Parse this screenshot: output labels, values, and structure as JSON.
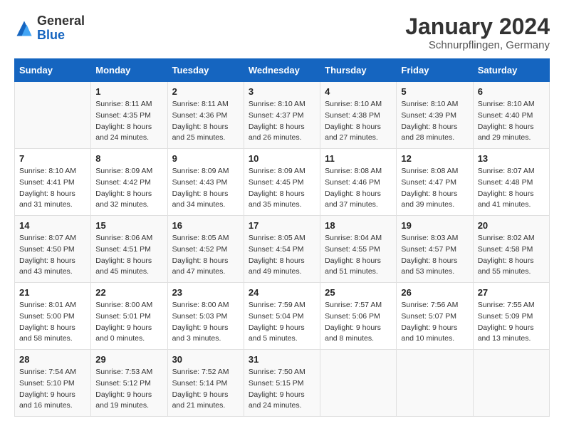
{
  "header": {
    "logo": {
      "general": "General",
      "blue": "Blue"
    },
    "title": "January 2024",
    "location": "Schnurpflingen, Germany"
  },
  "calendar": {
    "days_of_week": [
      "Sunday",
      "Monday",
      "Tuesday",
      "Wednesday",
      "Thursday",
      "Friday",
      "Saturday"
    ],
    "weeks": [
      [
        {
          "day": "",
          "info": ""
        },
        {
          "day": "1",
          "info": "Sunrise: 8:11 AM\nSunset: 4:35 PM\nDaylight: 8 hours\nand 24 minutes."
        },
        {
          "day": "2",
          "info": "Sunrise: 8:11 AM\nSunset: 4:36 PM\nDaylight: 8 hours\nand 25 minutes."
        },
        {
          "day": "3",
          "info": "Sunrise: 8:10 AM\nSunset: 4:37 PM\nDaylight: 8 hours\nand 26 minutes."
        },
        {
          "day": "4",
          "info": "Sunrise: 8:10 AM\nSunset: 4:38 PM\nDaylight: 8 hours\nand 27 minutes."
        },
        {
          "day": "5",
          "info": "Sunrise: 8:10 AM\nSunset: 4:39 PM\nDaylight: 8 hours\nand 28 minutes."
        },
        {
          "day": "6",
          "info": "Sunrise: 8:10 AM\nSunset: 4:40 PM\nDaylight: 8 hours\nand 29 minutes."
        }
      ],
      [
        {
          "day": "7",
          "info": "Sunrise: 8:10 AM\nSunset: 4:41 PM\nDaylight: 8 hours\nand 31 minutes."
        },
        {
          "day": "8",
          "info": "Sunrise: 8:09 AM\nSunset: 4:42 PM\nDaylight: 8 hours\nand 32 minutes."
        },
        {
          "day": "9",
          "info": "Sunrise: 8:09 AM\nSunset: 4:43 PM\nDaylight: 8 hours\nand 34 minutes."
        },
        {
          "day": "10",
          "info": "Sunrise: 8:09 AM\nSunset: 4:45 PM\nDaylight: 8 hours\nand 35 minutes."
        },
        {
          "day": "11",
          "info": "Sunrise: 8:08 AM\nSunset: 4:46 PM\nDaylight: 8 hours\nand 37 minutes."
        },
        {
          "day": "12",
          "info": "Sunrise: 8:08 AM\nSunset: 4:47 PM\nDaylight: 8 hours\nand 39 minutes."
        },
        {
          "day": "13",
          "info": "Sunrise: 8:07 AM\nSunset: 4:48 PM\nDaylight: 8 hours\nand 41 minutes."
        }
      ],
      [
        {
          "day": "14",
          "info": "Sunrise: 8:07 AM\nSunset: 4:50 PM\nDaylight: 8 hours\nand 43 minutes."
        },
        {
          "day": "15",
          "info": "Sunrise: 8:06 AM\nSunset: 4:51 PM\nDaylight: 8 hours\nand 45 minutes."
        },
        {
          "day": "16",
          "info": "Sunrise: 8:05 AM\nSunset: 4:52 PM\nDaylight: 8 hours\nand 47 minutes."
        },
        {
          "day": "17",
          "info": "Sunrise: 8:05 AM\nSunset: 4:54 PM\nDaylight: 8 hours\nand 49 minutes."
        },
        {
          "day": "18",
          "info": "Sunrise: 8:04 AM\nSunset: 4:55 PM\nDaylight: 8 hours\nand 51 minutes."
        },
        {
          "day": "19",
          "info": "Sunrise: 8:03 AM\nSunset: 4:57 PM\nDaylight: 8 hours\nand 53 minutes."
        },
        {
          "day": "20",
          "info": "Sunrise: 8:02 AM\nSunset: 4:58 PM\nDaylight: 8 hours\nand 55 minutes."
        }
      ],
      [
        {
          "day": "21",
          "info": "Sunrise: 8:01 AM\nSunset: 5:00 PM\nDaylight: 8 hours\nand 58 minutes."
        },
        {
          "day": "22",
          "info": "Sunrise: 8:00 AM\nSunset: 5:01 PM\nDaylight: 9 hours\nand 0 minutes."
        },
        {
          "day": "23",
          "info": "Sunrise: 8:00 AM\nSunset: 5:03 PM\nDaylight: 9 hours\nand 3 minutes."
        },
        {
          "day": "24",
          "info": "Sunrise: 7:59 AM\nSunset: 5:04 PM\nDaylight: 9 hours\nand 5 minutes."
        },
        {
          "day": "25",
          "info": "Sunrise: 7:57 AM\nSunset: 5:06 PM\nDaylight: 9 hours\nand 8 minutes."
        },
        {
          "day": "26",
          "info": "Sunrise: 7:56 AM\nSunset: 5:07 PM\nDaylight: 9 hours\nand 10 minutes."
        },
        {
          "day": "27",
          "info": "Sunrise: 7:55 AM\nSunset: 5:09 PM\nDaylight: 9 hours\nand 13 minutes."
        }
      ],
      [
        {
          "day": "28",
          "info": "Sunrise: 7:54 AM\nSunset: 5:10 PM\nDaylight: 9 hours\nand 16 minutes."
        },
        {
          "day": "29",
          "info": "Sunrise: 7:53 AM\nSunset: 5:12 PM\nDaylight: 9 hours\nand 19 minutes."
        },
        {
          "day": "30",
          "info": "Sunrise: 7:52 AM\nSunset: 5:14 PM\nDaylight: 9 hours\nand 21 minutes."
        },
        {
          "day": "31",
          "info": "Sunrise: 7:50 AM\nSunset: 5:15 PM\nDaylight: 9 hours\nand 24 minutes."
        },
        {
          "day": "",
          "info": ""
        },
        {
          "day": "",
          "info": ""
        },
        {
          "day": "",
          "info": ""
        }
      ]
    ]
  }
}
